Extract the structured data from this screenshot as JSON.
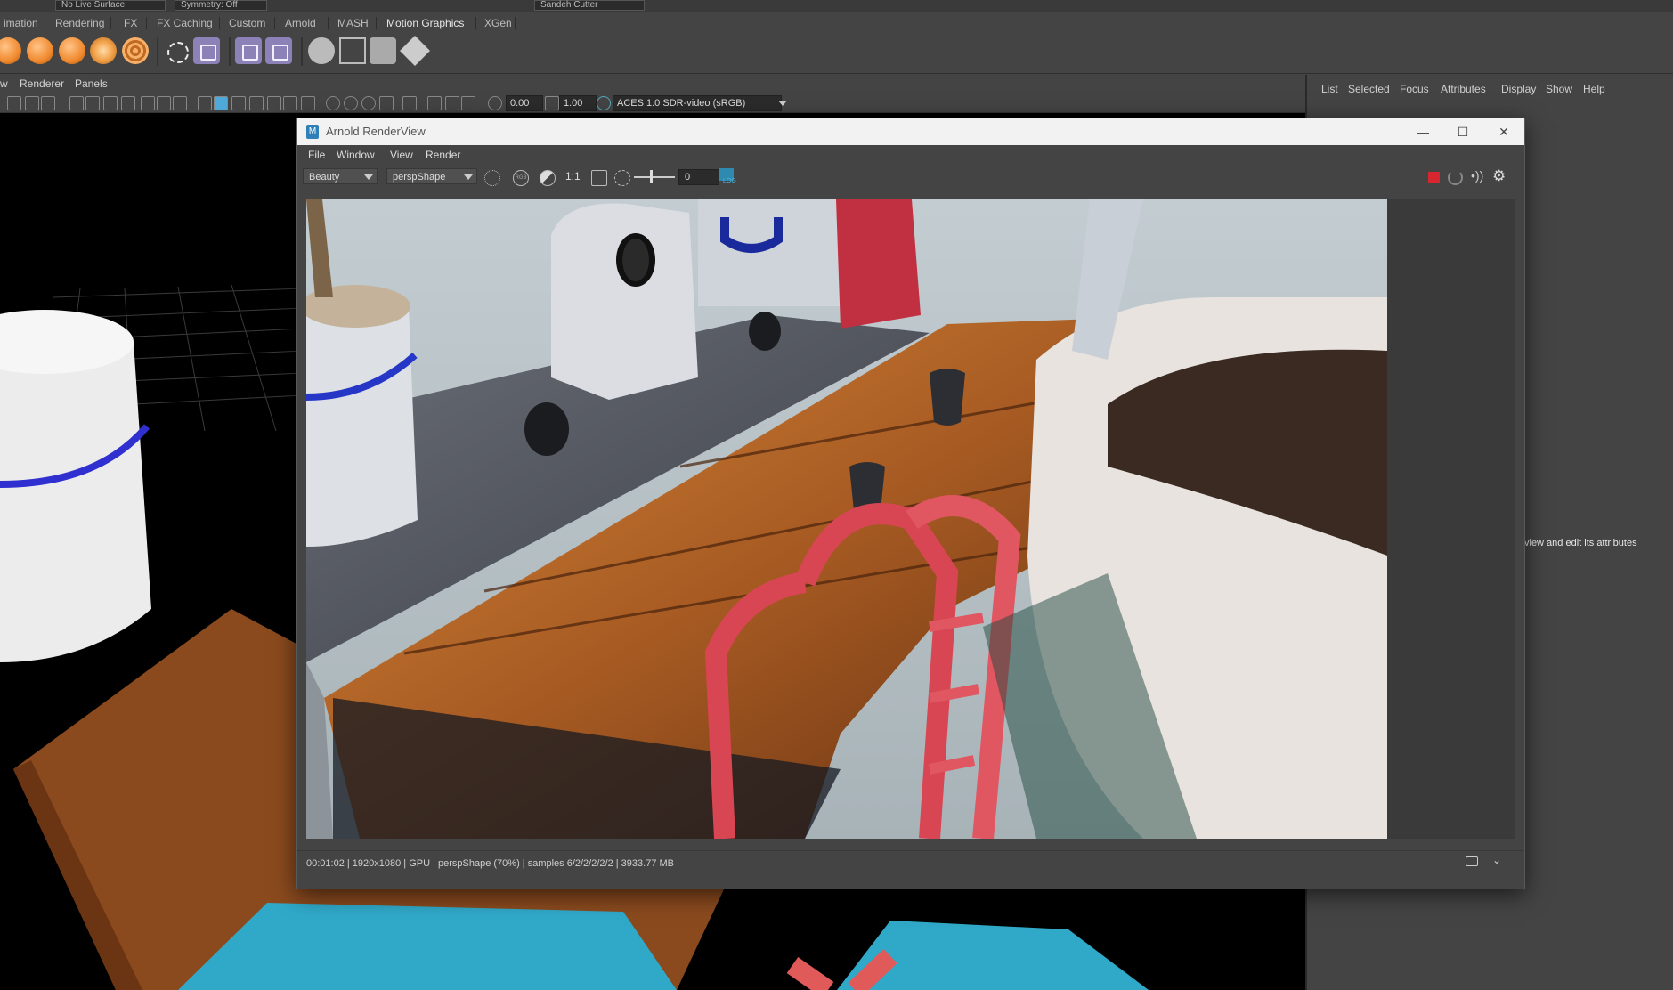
{
  "top_strip": {
    "field1": "No Live Surface",
    "field2": "Symmetry: Off",
    "field3": "Sandeh Cutter"
  },
  "shelf_tabs": [
    "imation",
    "Rendering",
    "FX",
    "FX Caching",
    "Custom",
    "Arnold",
    "MASH",
    "Motion Graphics",
    "XGen"
  ],
  "shelf_active_tab": "Motion Graphics",
  "viewport": {
    "menu": [
      "w",
      "Renderer",
      "Panels"
    ],
    "toolbar": {
      "exposure": "0.00",
      "gamma": "1.00",
      "colorspace": "ACES 1.0 SDR-video (sRGB)"
    }
  },
  "right_panel": {
    "menu": [
      "List",
      "Selected",
      "Focus",
      "Attributes",
      "Display",
      "Show",
      "Help"
    ],
    "hint": "view and edit its attributes"
  },
  "render_view": {
    "title": "Arnold RenderView",
    "window_buttons": {
      "minimize": "—",
      "maximize": "☐",
      "close": "✕"
    },
    "menu": [
      "File",
      "Window",
      "View",
      "Render"
    ],
    "aov_select": "Beauty",
    "camera_select": "perspShape",
    "ratio": "1:1",
    "exposure_value": "0",
    "log_label": "LOG",
    "status": "00:01:02 | 1920x1080 | GPU | perspShape (70%) | samples 6/2/2/2/2/2 | 3933.77 MB"
  },
  "colors": {
    "stop_button": "#d6262f",
    "viewport_bg": "#000000",
    "ui_bg": "#444444"
  }
}
